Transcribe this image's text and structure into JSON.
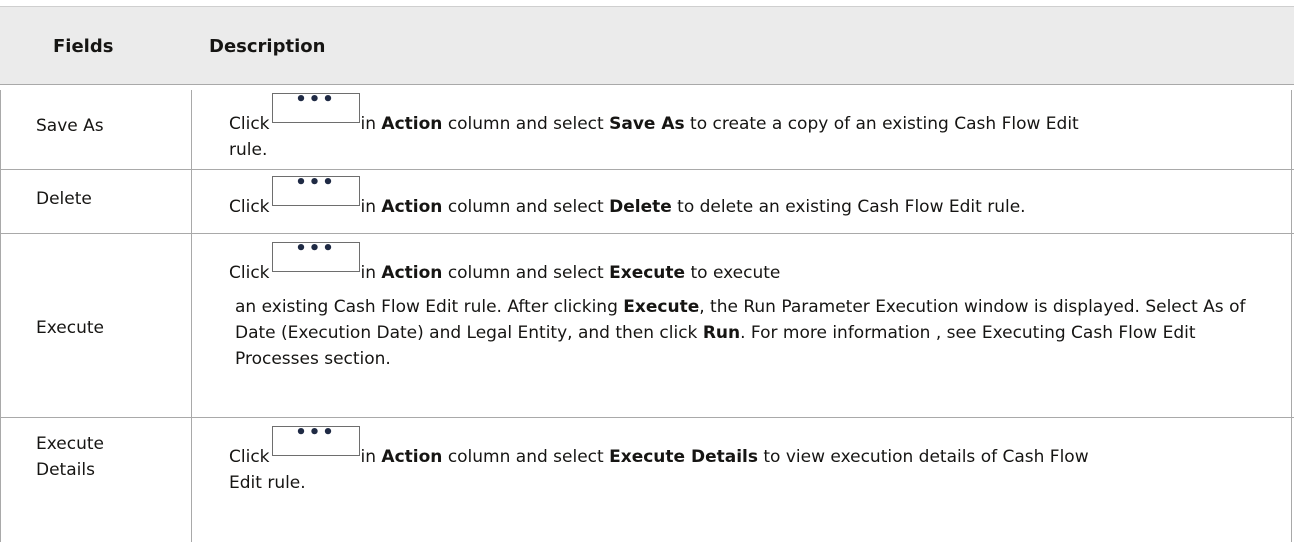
{
  "table": {
    "headers": {
      "fields": "Fields",
      "description": "Description"
    },
    "rows": [
      {
        "field": "Save As",
        "click": "Click",
        "icon": "more-actions-icon",
        "in_text": "in",
        "action_word": "Action",
        "column_select": "column and select",
        "option": "Save As",
        "rest": "to create a copy of an existing Cash Flow Edit",
        "line2": "rule."
      },
      {
        "field": "Delete",
        "click": "Click",
        "icon": "more-actions-icon",
        "in_text": "in",
        "action_word": "Action",
        "column_select": "column and select",
        "option": "Delete",
        "rest": "to delete an existing Cash Flow Edit rule."
      },
      {
        "field": "Execute",
        "click": "Click",
        "icon": "more-actions-icon",
        "in_text": "in",
        "action_word": "Action",
        "column_select": "column and select",
        "option": "Execute",
        "rest": "to execute",
        "p2_a": "an existing Cash Flow Edit rule. After clicking",
        "p2_b": "Execute",
        "p2_c": ", the Run Parameter Execution window is displayed. Select As of Date (Execution Date) and Legal Entity, and then click",
        "p2_d": "Run",
        "p2_e": ". For more information , see Executing Cash Flow Edit Processes section."
      },
      {
        "field_line1": "Execute",
        "field_line2": "Details",
        "click": "Click",
        "icon": "more-actions-icon",
        "in_text": "in",
        "action_word": "Action",
        "column_select": "column and select",
        "option": "Execute Details",
        "rest": "to view execution details of Cash Flow",
        "line2": "Edit rule."
      }
    ]
  }
}
